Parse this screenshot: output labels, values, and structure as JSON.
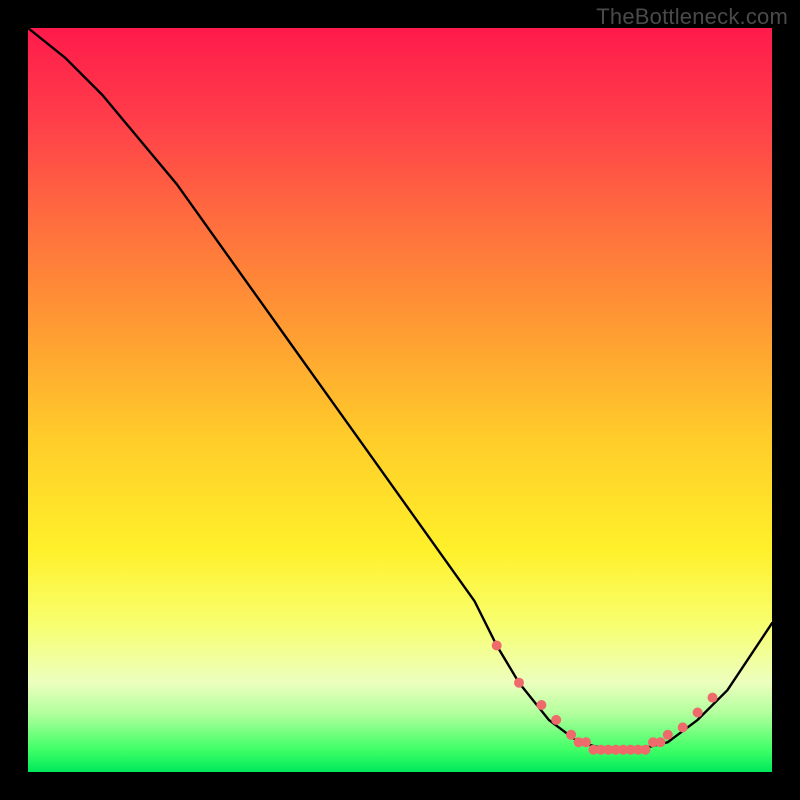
{
  "watermark": "TheBottleneck.com",
  "chart_data": {
    "type": "line",
    "title": "",
    "xlabel": "",
    "ylabel": "",
    "xlim": [
      0,
      100
    ],
    "ylim": [
      0,
      100
    ],
    "series": [
      {
        "name": "bottleneck-curve",
        "x": [
          0,
          5,
          10,
          15,
          20,
          25,
          30,
          35,
          40,
          45,
          50,
          55,
          60,
          63,
          66,
          70,
          74,
          78,
          82,
          86,
          90,
          94,
          100
        ],
        "y": [
          100,
          96,
          91,
          85,
          79,
          72,
          65,
          58,
          51,
          44,
          37,
          30,
          23,
          17,
          12,
          7,
          4,
          3,
          3,
          4,
          7,
          11,
          20
        ]
      }
    ],
    "markers": {
      "name": "highlight-dots",
      "color": "#ef6a6a",
      "x": [
        63,
        66,
        69,
        71,
        73,
        74,
        75,
        76,
        77,
        78,
        79,
        80,
        81,
        82,
        83,
        84,
        85,
        86,
        88,
        90,
        92
      ],
      "y": [
        17,
        12,
        9,
        7,
        5,
        4,
        4,
        3,
        3,
        3,
        3,
        3,
        3,
        3,
        3,
        4,
        4,
        5,
        6,
        8,
        10
      ]
    }
  }
}
